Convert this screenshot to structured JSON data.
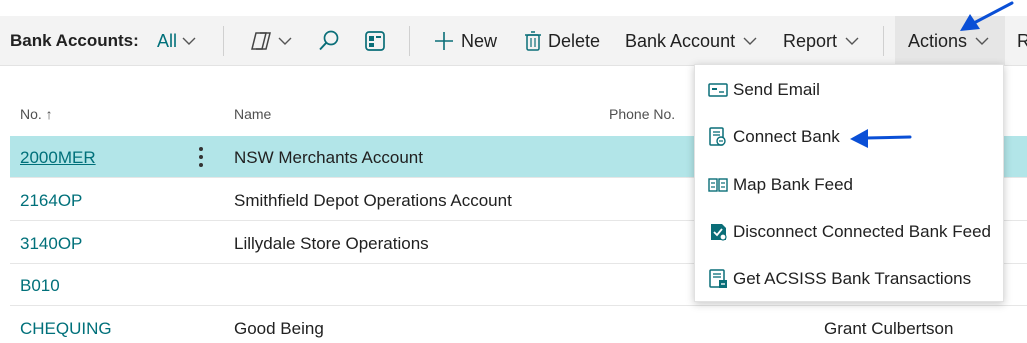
{
  "toolbar": {
    "title": "Bank Accounts:",
    "filter_label": "All",
    "buttons": {
      "new": "New",
      "delete": "Delete",
      "bank_account": "Bank Account",
      "report": "Report",
      "actions": "Actions",
      "overflow": "R"
    },
    "icons": [
      "copilot-icon",
      "search-icon",
      "filter-pane-icon",
      "plus-icon",
      "trash-icon",
      "chevron-down-icon"
    ]
  },
  "table": {
    "columns": {
      "no": "No. ↑",
      "name": "Name",
      "phone": "Phone No."
    },
    "rows": [
      {
        "no": "2000MER",
        "name": "NSW Merchants Account",
        "contact": ""
      },
      {
        "no": "2164OP",
        "name": "Smithfield Depot Operations Account",
        "contact": ""
      },
      {
        "no": "3140OP",
        "name": "Lillydale Store Operations",
        "contact": ""
      },
      {
        "no": "B010",
        "name": "",
        "contact": ""
      },
      {
        "no": "CHEQUING",
        "name": "Good Being",
        "contact": "Grant Culbertson"
      }
    ],
    "selected_row": 0
  },
  "actions_menu": {
    "items": [
      {
        "label": "Send Email",
        "icon": "email-icon"
      },
      {
        "label": "Connect Bank",
        "icon": "connect-bank-icon"
      },
      {
        "label": "Map Bank Feed",
        "icon": "map-feed-icon"
      },
      {
        "label": "Disconnect Connected Bank Feed",
        "icon": "disconnect-feed-icon"
      },
      {
        "label": "Get ACSISS Bank Transactions",
        "icon": "bank-transactions-icon"
      }
    ]
  },
  "colors": {
    "accent": "#00707a",
    "selected_row": "#b2e5e8",
    "annotation_arrow": "#0a4fd6",
    "toolbar_bg": "#f3f3f3"
  }
}
